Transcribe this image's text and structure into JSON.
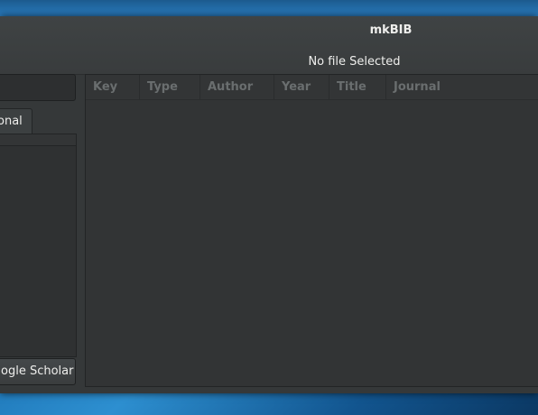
{
  "window": {
    "title": "mkBIB",
    "subtitle": "No file Selected"
  },
  "sidebar": {
    "search": {
      "value": "",
      "placeholder": ""
    },
    "tab_label": "onal",
    "scholar_button_label": "ogle Scholar"
  },
  "table": {
    "columns": [
      "Key",
      "Type",
      "Author",
      "Year",
      "Title",
      "Journal"
    ],
    "rows": []
  }
}
